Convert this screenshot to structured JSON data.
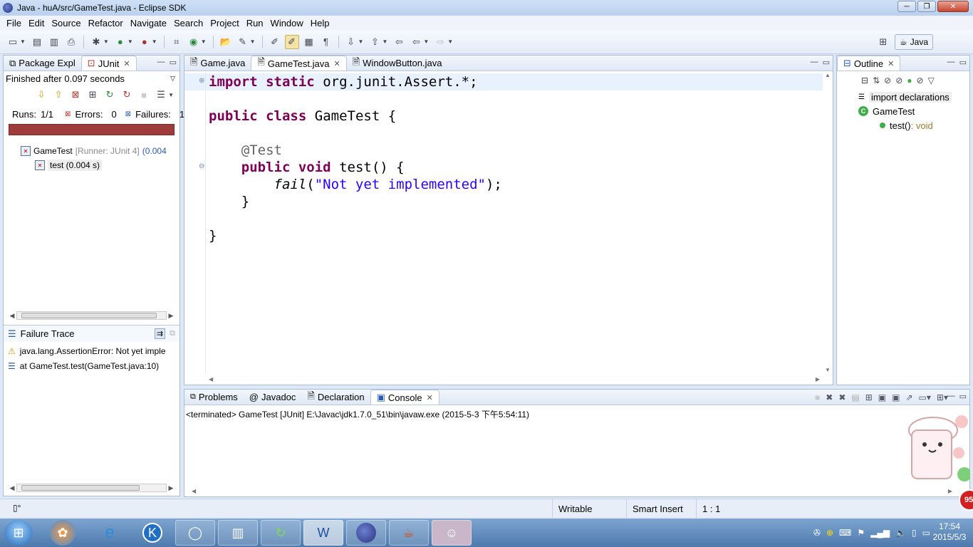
{
  "window": {
    "title": "Java - huA/src/GameTest.java - Eclipse SDK",
    "buttons": [
      "─",
      "❐",
      "✕"
    ]
  },
  "menu": [
    "File",
    "Edit",
    "Source",
    "Refactor",
    "Navigate",
    "Search",
    "Project",
    "Run",
    "Window",
    "Help"
  ],
  "perspective": {
    "label": "Java"
  },
  "junit": {
    "tabs": [
      {
        "label": "Package Expl"
      },
      {
        "label": "JUnit"
      }
    ],
    "status": "Finished after 0.097 seconds",
    "runs_label": "Runs:",
    "runs_value": "1/1",
    "errors_label": "Errors:",
    "errors_value": "0",
    "failures_label": "Failures:",
    "failures_value": "1",
    "progress_state": "failed",
    "progress_color": "#9e3b3b",
    "tree": [
      {
        "name": "GameTest",
        "runner": "[Runner: JUnit 4]",
        "time": "(0.004"
      },
      {
        "name": "test (0.004 s)"
      }
    ],
    "failure_trace_title": "Failure Trace",
    "trace": [
      "java.lang.AssertionError: Not yet imple",
      "at GameTest.test(GameTest.java:10)"
    ]
  },
  "editor": {
    "tabs": [
      {
        "label": "Game.java"
      },
      {
        "label": "GameTest.java"
      },
      {
        "label": "WindowButton.java"
      }
    ],
    "code": {
      "l1_kw1": "import",
      "l1_kw2": "static",
      "l1_rest": "org.junit.Assert.*;",
      "l4_kw1": "public",
      "l4_kw2": "class",
      "l4_rest": "GameTest {",
      "l6_ann": "@Test",
      "l7_kw1": "public",
      "l7_kw2": "void",
      "l7_rest": "test() {",
      "l8_fn": "fail",
      "l8_open": "(",
      "l8_str": "\"Not yet implemented\"",
      "l8_close": ");",
      "l9": "}",
      "l11": "}"
    }
  },
  "outline": {
    "tab": "Outline",
    "items": [
      {
        "label": "import declarations"
      },
      {
        "label": "GameTest"
      },
      {
        "label": "test()",
        "type": " : void"
      }
    ]
  },
  "console": {
    "tabs": [
      {
        "label": "Problems"
      },
      {
        "label": "Javadoc"
      },
      {
        "label": "Declaration"
      },
      {
        "label": "Console"
      }
    ],
    "output": "<terminated> GameTest [JUnit] E:\\Javac\\jdk1.7.0_51\\bin\\javaw.exe (2015-5-3 下午5:54:11)"
  },
  "statusbar": {
    "writable": "Writable",
    "insert_mode": "Smart Insert",
    "position": "1 : 1"
  },
  "taskbar": {
    "time": "17:54",
    "date": "2015/5/3",
    "badge": "95",
    "apps": [
      "windows-start-icon",
      "app-icon",
      "ie-icon",
      "k-icon",
      "qq-browser-icon",
      "media-icon",
      "refresh-app-icon",
      "word-icon",
      "eclipse-icon",
      "java-icon",
      "photo-icon"
    ]
  },
  "colors": {
    "keyword": "#7f0055",
    "string": "#2a00ff",
    "annotation": "#646464",
    "progress_failed": "#9e3b3b",
    "accent": "#2a5bb0"
  }
}
